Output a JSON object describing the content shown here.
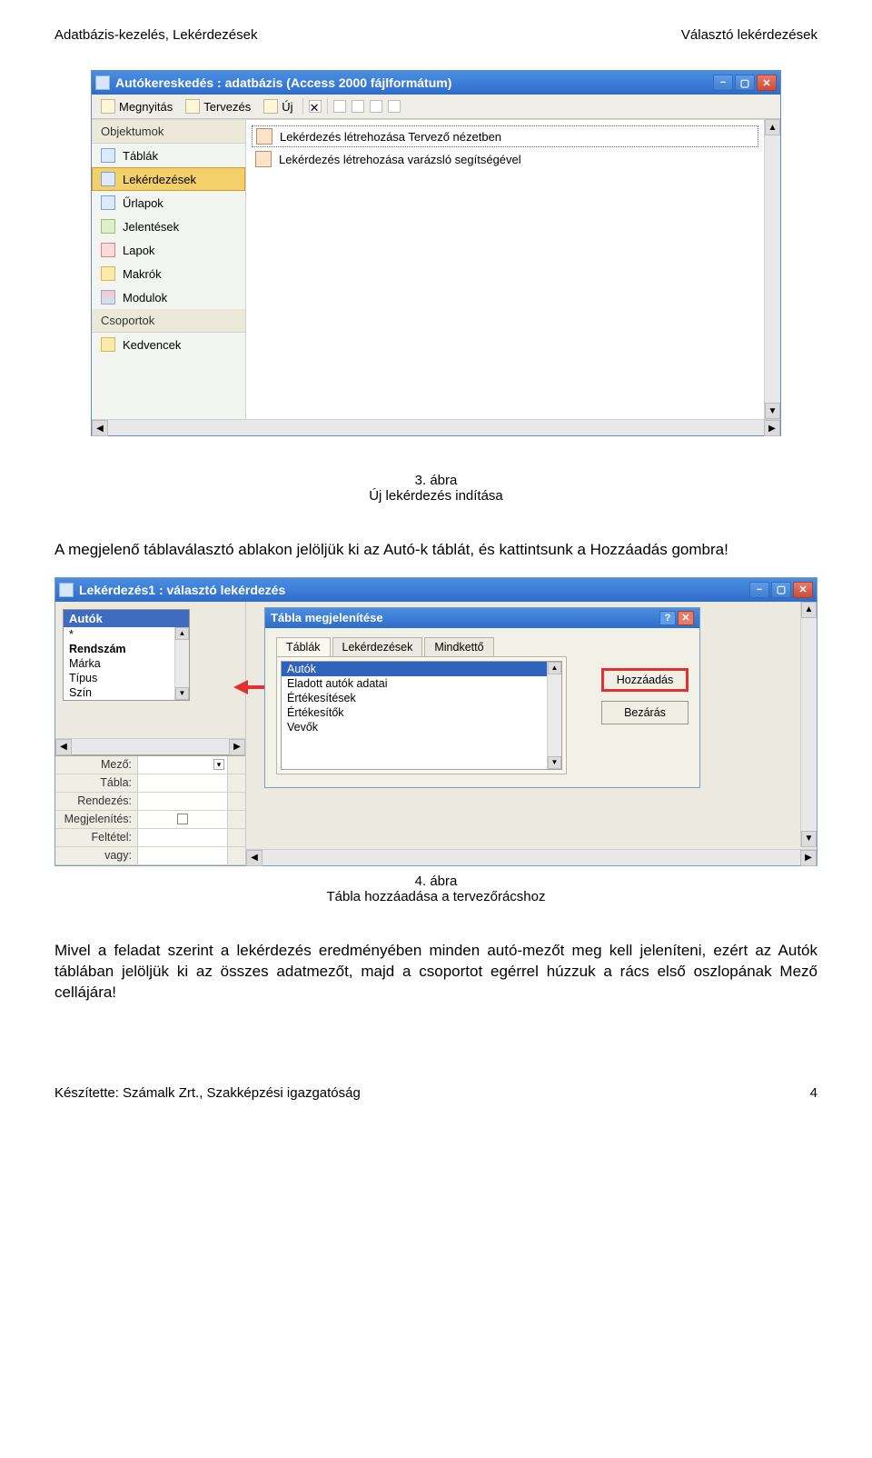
{
  "header": {
    "left": "Adatbázis-kezelés, Lekérdezések",
    "right": "Választó lekérdezések"
  },
  "dbwin": {
    "title": "Autókereskedés : adatbázis (Access 2000 fájlformátum)",
    "toolbar": {
      "open": "Megnyitás",
      "design": "Tervezés",
      "new": "Új"
    },
    "sidebar": {
      "group1": "Objektumok",
      "items": [
        "Táblák",
        "Lekérdezések",
        "Űrlapok",
        "Jelentések",
        "Lapok",
        "Makrók",
        "Modulok"
      ],
      "group2": "Csoportok",
      "fav": "Kedvencek"
    },
    "list": {
      "i1": "Lekérdezés létrehozása Tervező nézetben",
      "i2": "Lekérdezés létrehozása varázsló segítségével"
    }
  },
  "cap1": {
    "fig": "3. ábra",
    "txt": "Új lekérdezés indítása"
  },
  "para1": "A megjelenő táblaválasztó ablakon jelöljük ki az Autó-k táblát, és kattintsunk a Hozzáadás gombra!",
  "qwin": {
    "title": "Lekérdezés1 : választó lekérdezés",
    "fieldbox": {
      "title": "Autók",
      "star": "*",
      "f1": "Rendszám",
      "f2": "Márka",
      "f3": "Típus",
      "f4": "Szín"
    },
    "grid": {
      "l1": "Mező:",
      "l2": "Tábla:",
      "l3": "Rendezés:",
      "l4": "Megjelenítés:",
      "l5": "Feltétel:",
      "l6": "vagy:"
    },
    "dlg": {
      "title": "Tábla megjelenítése",
      "tabs": {
        "t1": "Táblák",
        "t2": "Lekérdezések",
        "t3": "Mindkettő"
      },
      "items": {
        "i1": "Autók",
        "i2": "Eladott autók adatai",
        "i3": "Értékesítések",
        "i4": "Értékesítők",
        "i5": "Vevők"
      },
      "btn1": "Hozzáadás",
      "btn2": "Bezárás"
    }
  },
  "cap2": {
    "fig": "4. ábra",
    "txt": "Tábla hozzáadása a tervezőrácshoz"
  },
  "para2": "Mivel a feladat szerint a lekérdezés eredményében minden autó-mezőt meg kell jeleníteni, ezért az Autók táblában jelöljük ki az összes adatmezőt, majd a csoportot egérrel húzzuk a rács első oszlopának Mező cellájára!",
  "footer": {
    "left": "Készítette: Számalk Zrt., Szakképzési igazgatóság",
    "right": "4"
  }
}
